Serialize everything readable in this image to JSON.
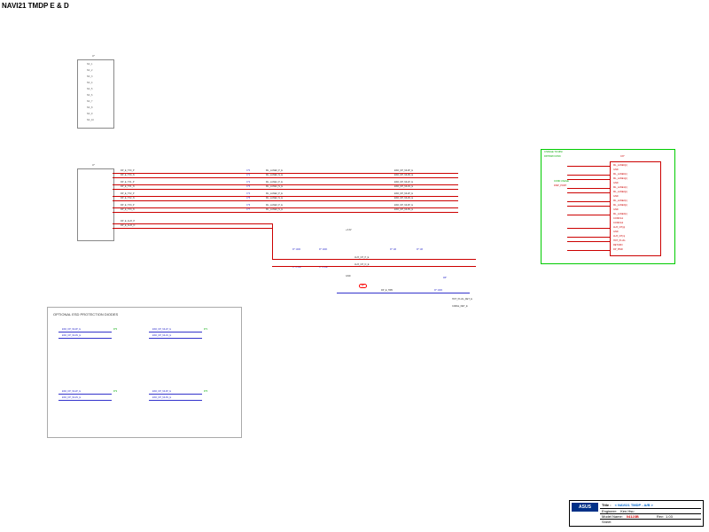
{
  "title": "NAVI21 TMDP E & D",
  "chipA": {
    "ref": "U*",
    "pins": [
      "NC_1",
      "NC_2",
      "NC_3",
      "NC_4",
      "NC_5",
      "NC_6",
      "NC_7",
      "NC_8",
      "NC_9",
      "NC_10"
    ]
  },
  "chipB": {
    "ref": "U*",
    "signals": [
      "DP_E_TX0_P",
      "DP_E_TX0_N",
      "DP_E_TX1_P",
      "DP_E_TX1_N",
      "DP_E_TX2_P",
      "DP_E_TX2_N",
      "DP_E_TX3_P",
      "DP_E_TX3_N",
      "DP_E_AUX_P",
      "DP_E_AUX_N",
      "DP_E_HPD"
    ]
  },
  "caps": [
    "C*0",
    "C*1",
    "C*2",
    "C*3",
    "C*4",
    "C*5",
    "C*6",
    "C*7"
  ],
  "cap_nets_l": [
    "ML_LANE0_P_E",
    "ML_LANE0_N_E",
    "ML_LANE1_P_E",
    "ML_LANE1_N_E",
    "ML_LANE2_P_E",
    "ML_LANE2_N_E",
    "ML_LANE3_P_E",
    "ML_LANE3_N_E"
  ],
  "cap_nets_r": [
    "ESD_DP_ML0P_E",
    "ESD_DP_ML0N_E",
    "ESD_DP_ML1P_E",
    "ESD_DP_ML1N_E",
    "ESD_DP_ML2P_E",
    "ESD_DP_ML2N_E",
    "ESD_DP_ML3P_E",
    "ESD_DP_ML3N_E"
  ],
  "aux": {
    "p": "DP_E_AUX_P",
    "n": "DP_E_AUX_N",
    "r1": "R* 100K",
    "r2": "R* 100K",
    "r3": "R* 1M",
    "r4": "R* 1M",
    "c1": "C* 0.1uF",
    "c2": "C* 0.1uF",
    "net1": "AUX_CH_P_E",
    "net2": "AUX_CH_N_E"
  },
  "hpd": {
    "sig": "DP_E_HPD",
    "r": "R* 100K",
    "d": "D*",
    "net": "HOT_PLUG_DET_E",
    "fb": "FB*",
    "cable": "CABLE_DET_E"
  },
  "pwr": {
    "v33": "+3.3V",
    "v5": "+5V",
    "gnd": "GND"
  },
  "conn": {
    "ref": "CN*",
    "type": "MINI-DP",
    "note1": "CHANGE TO MINI",
    "note2": "DP/HDMI CONN",
    "note3": "CONN USAGE",
    "note4": "DISP_PORT",
    "pins": [
      "ML_LANE0(p)",
      "GND",
      "ML_LANE0(n)",
      "ML_LANE1(p)",
      "GND",
      "ML_LANE1(n)",
      "ML_LANE2(p)",
      "GND",
      "ML_LANE2(n)",
      "ML_LANE3(p)",
      "GND",
      "ML_LANE3(n)",
      "CONFIG1",
      "CONFIG2",
      "AUX_CH(p)",
      "GND",
      "AUX_CH(n)",
      "HOT_PLUG",
      "RETURN",
      "DP_PWR"
    ]
  },
  "esd_block": {
    "title": "OPTIONAL ESD PROTECTION DIODES",
    "groups": [
      "D*0",
      "D*1",
      "D*2",
      "D*3"
    ],
    "nets": [
      [
        "ESD_DP_ML0P_E",
        "ESD_DP_ML0N_E"
      ],
      [
        "ESD_DP_ML1P_E",
        "ESD_DP_ML1N_E"
      ],
      [
        "ESD_DP_ML2P_E",
        "ESD_DP_ML2N_E"
      ],
      [
        "ESD_DP_ML3P_E",
        "ESD_DP_ML3N_E"
      ]
    ]
  },
  "tb": {
    "brand": "ASUS",
    "title_l": "Title :",
    "title_v": "< NAVI21 TMDP - A/B >",
    "eng_l": "Engineer:",
    "eng_v": "Ken Hsu",
    "model_l": "Model Name:",
    "model_v": "04123B",
    "rev_l": "Rev:",
    "rev_v": "1.03",
    "sheet": "Sheet"
  }
}
